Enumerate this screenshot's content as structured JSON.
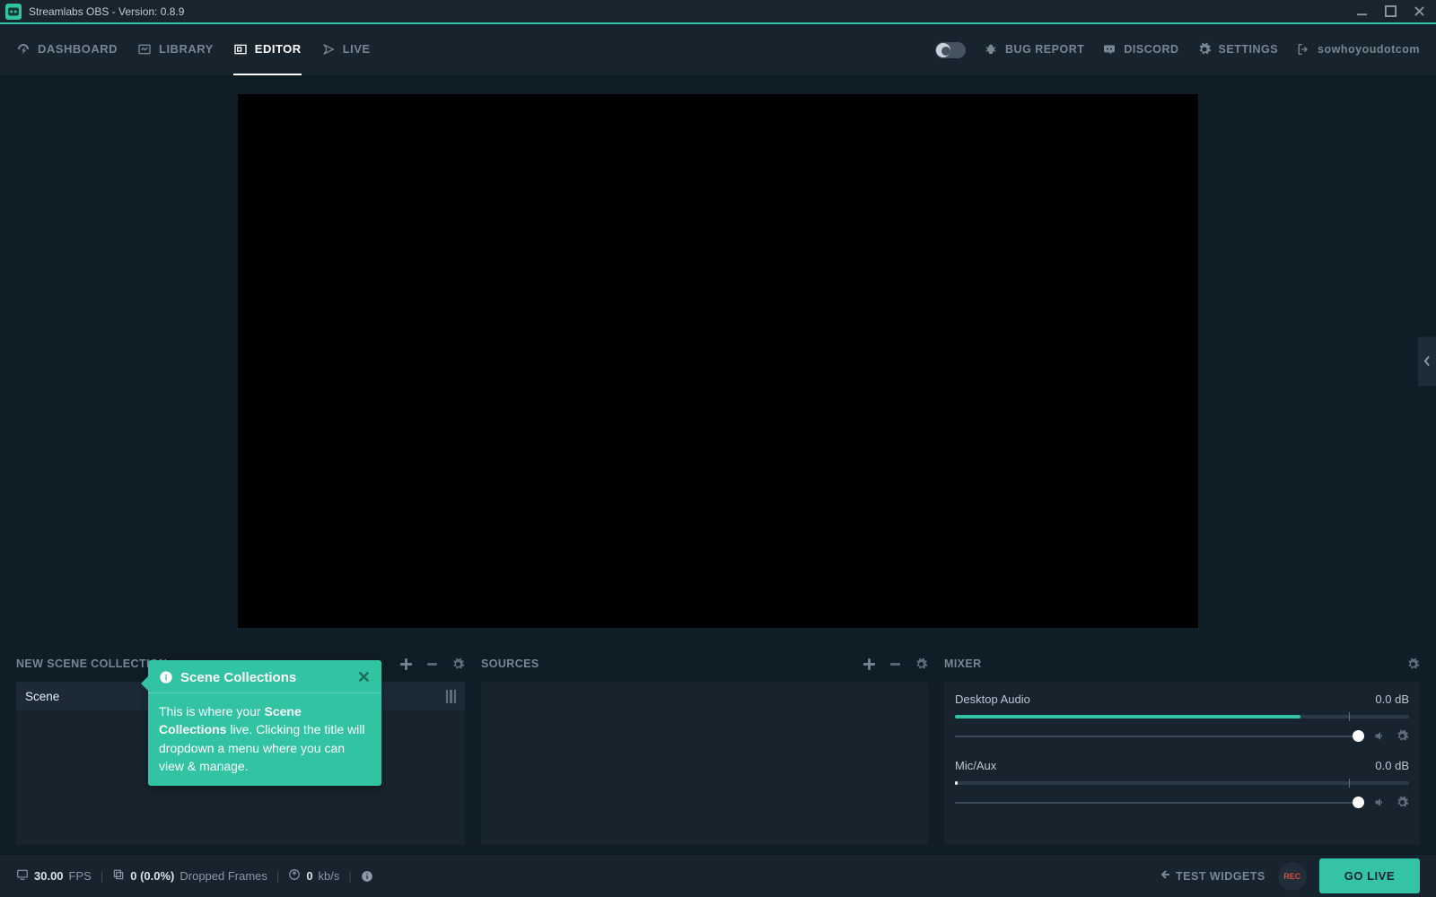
{
  "titlebar": {
    "app_title": "Streamlabs OBS - Version: 0.8.9"
  },
  "nav": {
    "left": [
      {
        "label": "DASHBOARD",
        "icon": "dashboard-icon",
        "active": false
      },
      {
        "label": "LIBRARY",
        "icon": "library-icon",
        "active": false
      },
      {
        "label": "EDITOR",
        "icon": "editor-icon",
        "active": true
      },
      {
        "label": "LIVE",
        "icon": "live-icon",
        "active": false
      }
    ],
    "right": {
      "bug_report": "BUG REPORT",
      "discord": "DISCORD",
      "settings": "SETTINGS",
      "user": "sowhoyoudotcom"
    }
  },
  "panels": {
    "scenes": {
      "header_label": "NEW SCENE COLLECTION",
      "items": [
        {
          "label": "Scene"
        }
      ]
    },
    "sources": {
      "header_label": "SOURCES"
    },
    "mixer": {
      "header_label": "MIXER",
      "channels": [
        {
          "name": "Desktop Audio",
          "db": "0.0 dB",
          "meter_fill": 76
        },
        {
          "name": "Mic/Aux",
          "db": "0.0 dB",
          "meter_fill": 0
        }
      ]
    }
  },
  "tooltip": {
    "title": "Scene Collections",
    "body_pre": "This is where your ",
    "body_bold": "Scene Collections",
    "body_post": " live. Clicking the title will dropdown a menu where you can view & manage."
  },
  "footer": {
    "fps_value": "30.00",
    "fps_label": "FPS",
    "dropped_value": "0 (0.0%)",
    "dropped_label": "Dropped Frames",
    "bitrate_value": "0",
    "bitrate_label": "kb/s",
    "test_widgets": "TEST WIDGETS",
    "rec": "REC",
    "go_live": "GO LIVE"
  }
}
